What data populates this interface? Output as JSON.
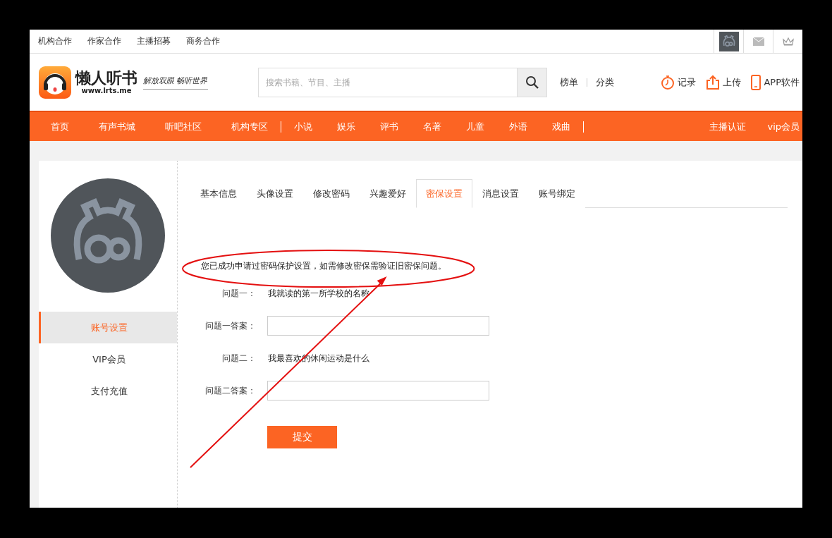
{
  "top_bar": {
    "links": [
      "机构合作",
      "作家合作",
      "主播招募",
      "商务合作"
    ]
  },
  "header": {
    "logo": {
      "name": "懒人听书",
      "url": "www.lrts.me",
      "slogan": "解放双眼 畅听世界"
    },
    "search": {
      "placeholder": "搜索书籍、节目、主播"
    },
    "links": [
      "榜单",
      "分类"
    ],
    "actions": [
      {
        "kind": "history",
        "label": "记录"
      },
      {
        "kind": "upload",
        "label": "上传"
      },
      {
        "kind": "app",
        "label": "APP软件"
      }
    ]
  },
  "nav": {
    "left": [
      "首页",
      "有声书城",
      "听吧社区",
      "机构专区"
    ],
    "categories": [
      "小说",
      "娱乐",
      "评书",
      "名著",
      "儿童",
      "外语",
      "戏曲"
    ],
    "right": [
      "主播认证",
      "vip会员"
    ]
  },
  "sidebar": {
    "items": [
      {
        "label": "账号设置",
        "selected": true
      },
      {
        "label": "VIP会员",
        "selected": false
      },
      {
        "label": "支付充值",
        "selected": false
      }
    ]
  },
  "tabs": [
    {
      "label": "基本信息",
      "selected": false
    },
    {
      "label": "头像设置",
      "selected": false
    },
    {
      "label": "修改密码",
      "selected": false
    },
    {
      "label": "兴趣爱好",
      "selected": false
    },
    {
      "label": "密保设置",
      "selected": true
    },
    {
      "label": "消息设置",
      "selected": false
    },
    {
      "label": "账号绑定",
      "selected": false
    }
  ],
  "notice": "您已成功申请过密码保护设置，如需修改密保需验证旧密保问题。",
  "form": {
    "rows": [
      {
        "kind": "question",
        "label": "问题一：",
        "value": "我就读的第一所学校的名称"
      },
      {
        "kind": "answer",
        "label": "问题一答案："
      },
      {
        "kind": "question",
        "label": "问题二：",
        "value": "我最喜欢的休闲运动是什么"
      },
      {
        "kind": "answer",
        "label": "问题二答案："
      }
    ],
    "submit": "提交"
  }
}
